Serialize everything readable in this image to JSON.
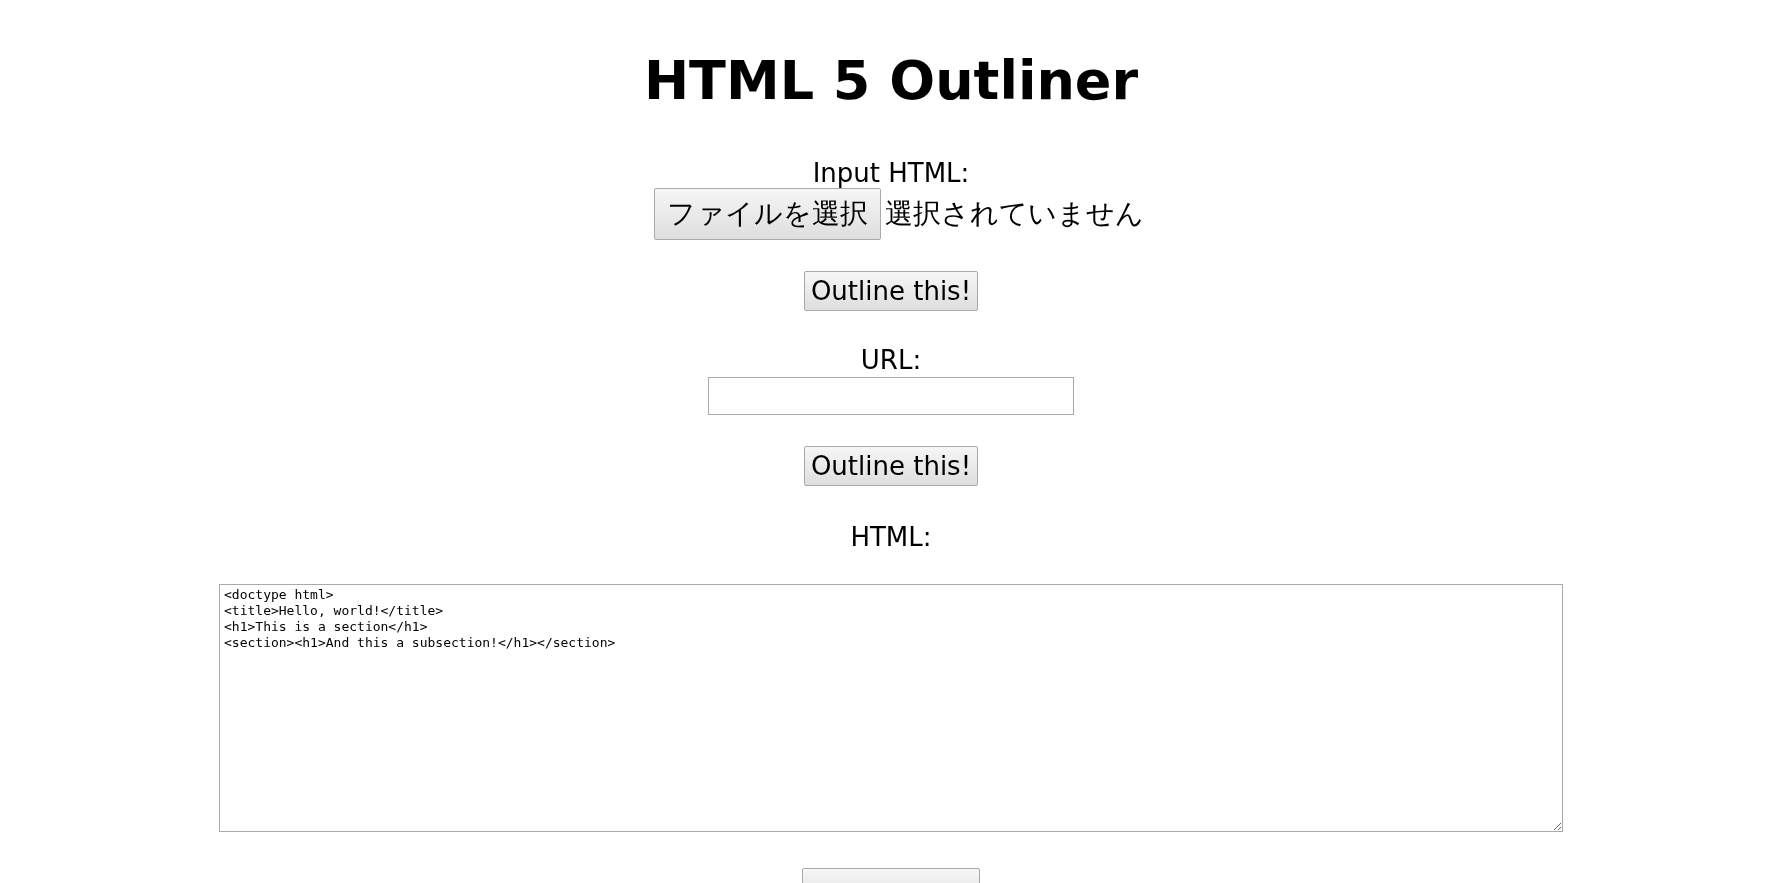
{
  "title": "HTML 5 Outliner",
  "file_section": {
    "label": "Input HTML:",
    "button": "ファイルを選択",
    "status": "選択されていません",
    "submit": "Outline this!"
  },
  "url_section": {
    "label": "URL:",
    "submit": "Outline this!"
  },
  "html_section": {
    "label": "HTML:",
    "value": "<doctype html>\n<title>Hello, world!</title>\n<h1>This is a section</h1>\n<section><h1>And this a subsection!</h1></section>"
  }
}
